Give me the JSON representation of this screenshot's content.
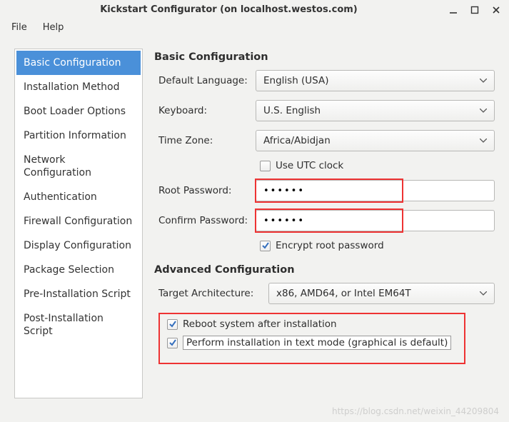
{
  "window": {
    "title": "Kickstart Configurator (on localhost.westos.com)"
  },
  "menu": {
    "file": "File",
    "help": "Help"
  },
  "sidebar": {
    "items": [
      "Basic Configuration",
      "Installation Method",
      "Boot Loader Options",
      "Partition Information",
      "Network Configuration",
      "Authentication",
      "Firewall Configuration",
      "Display Configuration",
      "Package Selection",
      "Pre-Installation Script",
      "Post-Installation Script"
    ],
    "selected_index": 0
  },
  "basic": {
    "heading": "Basic Configuration",
    "labels": {
      "default_language": "Default Language:",
      "keyboard": "Keyboard:",
      "time_zone": "Time Zone:",
      "root_password": "Root Password:",
      "confirm_password": "Confirm Password:"
    },
    "values": {
      "default_language": "English (USA)",
      "keyboard": "U.S. English",
      "time_zone": "Africa/Abidjan",
      "root_password": "••••••",
      "confirm_password": "••••••"
    },
    "utc": {
      "label": "Use UTC clock",
      "checked": false
    },
    "encrypt": {
      "label": "Encrypt root password",
      "checked": true
    }
  },
  "advanced": {
    "heading": "Advanced Configuration",
    "labels": {
      "target_arch": "Target Architecture:"
    },
    "values": {
      "target_arch": "x86, AMD64, or Intel EM64T"
    },
    "reboot": {
      "label": "Reboot system after installation",
      "checked": true
    },
    "textmode": {
      "label": "Perform installation in text mode (graphical is default)",
      "checked": true
    }
  },
  "watermark": "https://blog.csdn.net/weixin_44209804"
}
